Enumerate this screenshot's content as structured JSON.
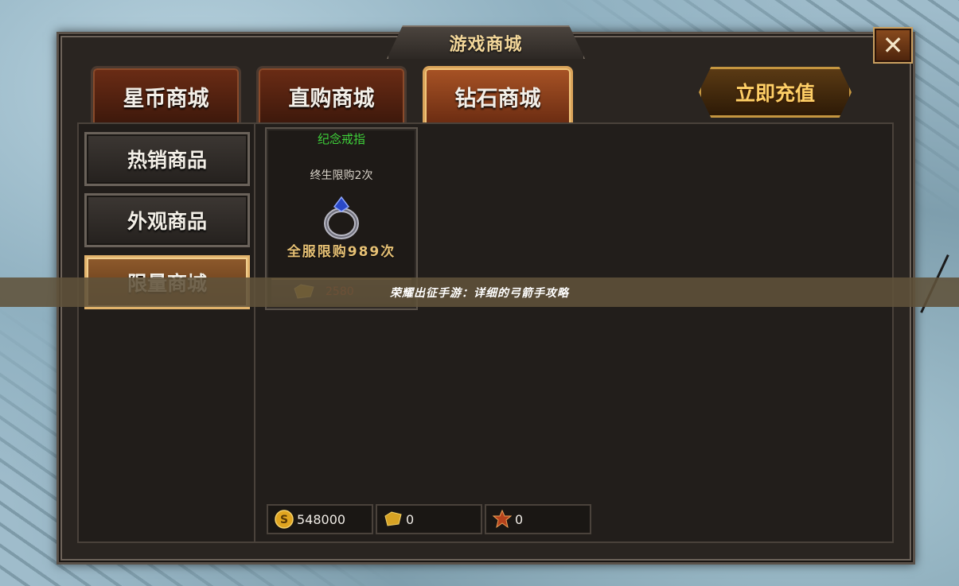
{
  "window": {
    "title": "游戏商城",
    "close": "✕"
  },
  "tabs": [
    {
      "label": "星币商城",
      "active": false
    },
    {
      "label": "直购商城",
      "active": false
    },
    {
      "label": "钻石商城",
      "active": true
    }
  ],
  "recharge_label": "立即充值",
  "sidebar": [
    {
      "label": "热销商品",
      "active": false
    },
    {
      "label": "外观商品",
      "active": false
    },
    {
      "label": "限量商城",
      "active": true
    }
  ],
  "item": {
    "name": "纪念戒指",
    "limit": "终生限购2次",
    "server_limit": "全服限购989次",
    "price": "2580",
    "icon": "ring-icon"
  },
  "overlay_text": "荣耀出征手游：详细的弓箭手攻略",
  "currencies": [
    {
      "icon": "coin-icon",
      "value": "548000"
    },
    {
      "icon": "diamond-icon",
      "value": "0"
    },
    {
      "icon": "badge-icon",
      "value": "0"
    }
  ],
  "colors": {
    "tab_active_border": "#d9a35a",
    "item_name": "#3fd13a",
    "server_limit": "#e7c175",
    "price": "#c04420"
  }
}
